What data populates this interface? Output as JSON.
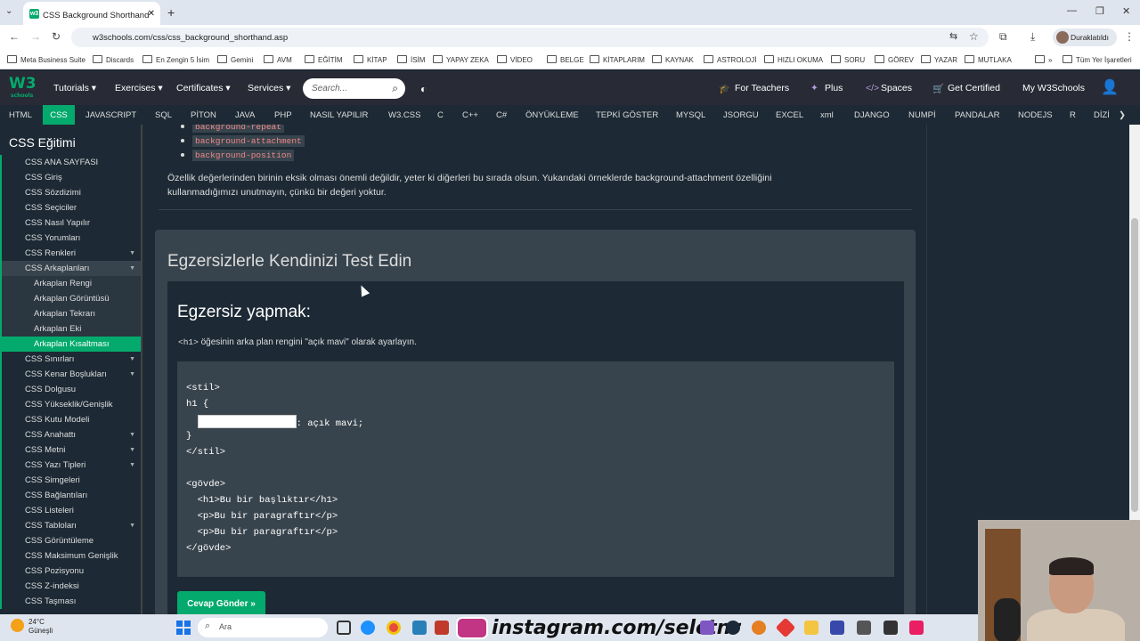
{
  "browser": {
    "tab_title": "CSS Background Shorthand",
    "url": "w3schools.com/css/css_background_shorthand.asp",
    "profile": "Duraklatıldı"
  },
  "bookmarks": [
    "Meta Business Suite",
    "Discards",
    "En Zengin 5 İsim",
    "Gemini",
    "AVM",
    "EĞİTİM",
    "KİTAP",
    "İSİM",
    "YAPAY ZEKA",
    "VİDEO",
    "BELGE",
    "KİTAPLARIM",
    "KAYNAK",
    "ASTROLOJİ",
    "HIZLI OKUMA",
    "SORU",
    "GÖREV",
    "YAZAR",
    "MUTLAKA",
    "Tüm Yer İşaretleri"
  ],
  "topnav": {
    "logo": "W3",
    "logo_sub": "schools",
    "tutorials": "Tutorials ▾",
    "exercises": "Exercises ▾",
    "certificates": "Certificates ▾",
    "services": "Services ▾",
    "search_placeholder": "Search...",
    "for_teachers": "For Teachers",
    "plus": "Plus",
    "spaces": "Spaces",
    "get_certified": "Get Certified",
    "my_w3": "My W3Schools"
  },
  "langbar": [
    "HTML",
    "CSS",
    "JAVASCRIPT",
    "SQL",
    "PİTON",
    "JAVA",
    "PHP",
    "NASIL YAPILIR",
    "W3.CSS",
    "C",
    "C++",
    "C#",
    "ÖNYÜKLEME",
    "TEPKİ GÖSTER",
    "MYSQL",
    "JSORGU",
    "EXCEL",
    "xml",
    "DJANGO",
    "NUMPİ",
    "PANDALAR",
    "NODEJS",
    "R",
    "DİZİ"
  ],
  "sidebar": {
    "title": "CSS Eğitimi",
    "items": [
      {
        "label": "CSS ANA SAYFASI",
        "type": "top"
      },
      {
        "label": "CSS Giriş",
        "type": "top"
      },
      {
        "label": "CSS Sözdizimi",
        "type": "top"
      },
      {
        "label": "CSS Seçiciler",
        "type": "top"
      },
      {
        "label": "CSS Nasıl Yapılır",
        "type": "top"
      },
      {
        "label": "CSS Yorumları",
        "type": "top"
      },
      {
        "label": "CSS Renkleri",
        "type": "top",
        "caret": true
      },
      {
        "label": "CSS Arkaplanları",
        "type": "open",
        "caret": true
      },
      {
        "label": "Arkaplan Rengi",
        "type": "sub"
      },
      {
        "label": "Arkaplan Görüntüsü",
        "type": "sub"
      },
      {
        "label": "Arkaplan Tekrarı",
        "type": "sub"
      },
      {
        "label": "Arkaplan Eki",
        "type": "sub"
      },
      {
        "label": "Arkaplan Kısaltması",
        "type": "active"
      },
      {
        "label": "CSS Sınırları",
        "type": "top",
        "caret": true
      },
      {
        "label": "CSS Kenar Boşlukları",
        "type": "top",
        "caret": true
      },
      {
        "label": "CSS Dolgusu",
        "type": "top"
      },
      {
        "label": "CSS Yükseklik/Genişlik",
        "type": "top"
      },
      {
        "label": "CSS Kutu Modeli",
        "type": "top"
      },
      {
        "label": "CSS Anahattı",
        "type": "top",
        "caret": true
      },
      {
        "label": "CSS Metni",
        "type": "top",
        "caret": true
      },
      {
        "label": "CSS Yazı Tipleri",
        "type": "top",
        "caret": true
      },
      {
        "label": "CSS Simgeleri",
        "type": "top"
      },
      {
        "label": "CSS Bağlantıları",
        "type": "top"
      },
      {
        "label": "CSS Listeleri",
        "type": "top"
      },
      {
        "label": "CSS Tabloları",
        "type": "top",
        "caret": true
      },
      {
        "label": "CSS Görüntüleme",
        "type": "top"
      },
      {
        "label": "CSS Maksimum Genişlik",
        "type": "top"
      },
      {
        "label": "CSS Pozisyonu",
        "type": "top"
      },
      {
        "label": "CSS Z-indeksi",
        "type": "top"
      },
      {
        "label": "CSS Taşması",
        "type": "top"
      }
    ]
  },
  "main": {
    "props": [
      "background-repeat",
      "background-attachment",
      "background-position"
    ],
    "paragraph": "Özellik değerlerinden birinin eksik olması önemli değildir, yeter ki diğerleri bu sırada olsun. Yukarıdaki örneklerde background-attachment özelliğini kullanmadığımızı unutmayın, çünkü bir değeri yoktur.",
    "exercise_title": "Egzersizlerle Kendinizi Test Edin",
    "exercise_heading": "Egzersiz yapmak:",
    "exercise_tag": "<h1>",
    "exercise_desc": " öğesinin arka plan rengini \"açık mavi\" olarak ayarlayın.",
    "code_lines": [
      "<stil>",
      "h1 {",
      "BLANK: açık mavi;",
      "}",
      "</stil>",
      "",
      "<gövde>",
      "  <h1>Bu bir başlıktır</h1>",
      "  <p>Bu bir paragraftır</p>",
      "  <p>Bu bir paragraftır</p>",
      "</gövde>"
    ],
    "code_after_blank": ": açık mavi;",
    "submit": "Cevap Gönder »"
  },
  "taskbar": {
    "temp": "24°C",
    "weather": "Güneşli",
    "search": "Ara",
    "instagram": "instagram.com/selctnr"
  },
  "colors": {
    "accent": "#04aa6d",
    "dark": "#1d2a35",
    "panel": "#38444d",
    "nav": "#282a35"
  }
}
